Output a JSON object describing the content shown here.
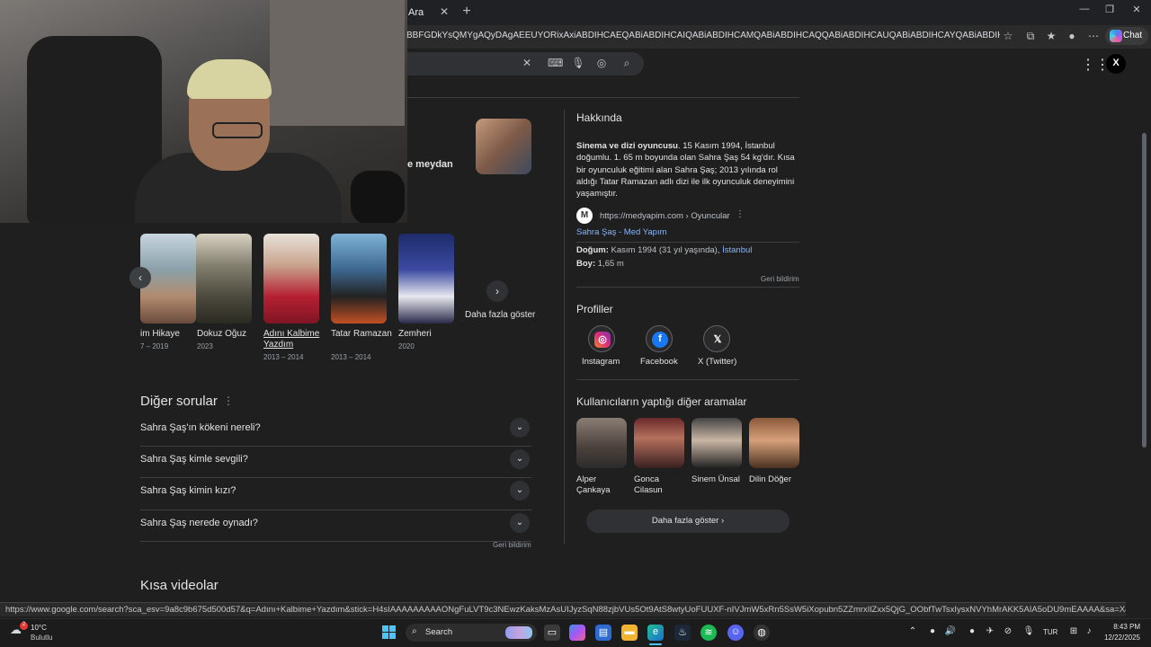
{
  "browser": {
    "tab_title": "Ara",
    "tab_close": "✕",
    "new_tab": "+",
    "url": "BBFGDkYsQMYgAQyDAgAEEUYORixAxiABDIHCAEQABiABDIHCAIQABiABDIHCAMQABiABDIHCAQQABiABDIHCAUQABiABDIHCAYQABiABDIHCAcQABiABNIBC...",
    "copilot_label": "Chat",
    "window_buttons": [
      "—",
      "❐",
      "✕"
    ]
  },
  "search": {
    "apps_icon": "grid-icon",
    "account_label": "X"
  },
  "left": {
    "partial_text": "e meydan",
    "shows": [
      {
        "title": "im Hikaye",
        "year": "7 – 2019"
      },
      {
        "title": "Dokuz Oğuz",
        "year": "2023"
      },
      {
        "title": "Adını Kalbime Yazdım",
        "year": "2013 – 2014"
      },
      {
        "title": "Tatar Ramazan",
        "year": "2013 – 2014"
      },
      {
        "title": "Zemheri",
        "year": "2020"
      }
    ],
    "more_shows": "Daha fazla göster",
    "questions_title": "Diğer sorular",
    "questions": [
      "Sahra Şaş'ın kökeni nereli?",
      "Sahra Şaş kimle sevgili?",
      "Sahra Şaş kimin kızı?",
      "Sahra Şaş nerede oynadı?"
    ],
    "feedback": "Geri bildirim",
    "short_videos_title": "Kısa videolar"
  },
  "right": {
    "about_title": "Hakkında",
    "about_bold": "Sinema ve dizi oyuncusu",
    "about_text": ". 15 Kasım 1994, İstanbul doğumlu. 1. 65 m boyunda olan Sahra Şaş 54 kg'dır. Kısa bir oyunculuk eğitimi alan Sahra Şaş; 2013 yılında rol aldığı Tatar Ramazan adlı dizi ile ilk oyunculuk deneyimini yaşamıştır.",
    "source_logo": "M",
    "source_url": "https://medyapim.com › Oyuncular",
    "source_link": "Sahra Şaş - Med Yapım",
    "birth_label": "Doğum:",
    "birth_value": "Kasım 1994 (31 yıl yaşında),",
    "birth_place": "İstanbul",
    "height_label": "Boy:",
    "height_value": "1,65 m",
    "feedback": "Geri bildirim",
    "profiles_title": "Profiller",
    "profiles": [
      "Instagram",
      "Facebook",
      "X (Twitter)"
    ],
    "related_title": "Kullanıcıların yaptığı diğer aramalar",
    "related": [
      "Alper Çankaya",
      "Gonca Cilasun",
      "Sinem Ünsal",
      "Dilin Döğer"
    ],
    "more_button": "Daha fazla göster  ›"
  },
  "status_url": "https://www.google.com/search?sca_esv=9a8c9b675d500d57&q=Adını+Kalbime+Yazdım&stick=H4sIAAAAAAAAAONgFuLVT9c3NEwzKaksMzAsUIJyzSqN88zjbVUs5Ot9AtS8wtyUoFUUXF-nIVJmW5xRn5SsW5iXopubn5ZZmrxIlZxx5QjG_OObfTwTsxIysxNVYhMrAKK5AIA5oDU9mEAAAA&sa=X&ved=2ah...",
  "taskbar": {
    "weather_temp": "10°C",
    "weather_desc": "Bulutlu",
    "weather_badge": "2",
    "search_label": "Search",
    "lang": "TUR",
    "time": "8:43 PM",
    "date": "12/22/2025"
  }
}
